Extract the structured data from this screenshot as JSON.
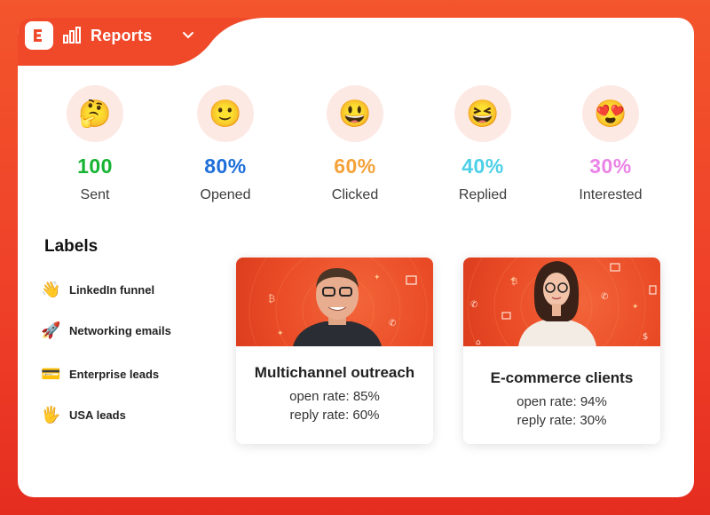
{
  "header": {
    "title": "Reports",
    "logo_letter": "E"
  },
  "stats": [
    {
      "emoji": "🤔",
      "value": "100",
      "label": "Sent",
      "color": "#16b332"
    },
    {
      "emoji": "🙂",
      "value": "80%",
      "label": "Opened",
      "color": "#1e6fd9"
    },
    {
      "emoji": "😃",
      "value": "60%",
      "label": "Clicked",
      "color": "#f5a23a"
    },
    {
      "emoji": "😆",
      "value": "40%",
      "label": "Replied",
      "color": "#4dd0e8"
    },
    {
      "emoji": "😍",
      "value": "30%",
      "label": "Interested",
      "color": "#ea84e6"
    }
  ],
  "labels": {
    "title": "Labels",
    "items": [
      {
        "emoji": "👋",
        "text": "LinkedIn funnel"
      },
      {
        "emoji": "🚀",
        "text": "Networking emails"
      },
      {
        "emoji": "💳",
        "text": "Enterprise leads"
      },
      {
        "emoji": "🖐",
        "text": "USA leads"
      }
    ]
  },
  "cards": [
    {
      "title": "Multichannel outreach",
      "open_rate": "open rate: 85%",
      "reply_rate": "reply rate: 60%"
    },
    {
      "title": "E-commerce clients",
      "open_rate": "open rate: 94%",
      "reply_rate": "reply rate: 30%"
    }
  ],
  "colors": {
    "brand": "#f0482a",
    "circle_bg": "#fde9e4"
  }
}
